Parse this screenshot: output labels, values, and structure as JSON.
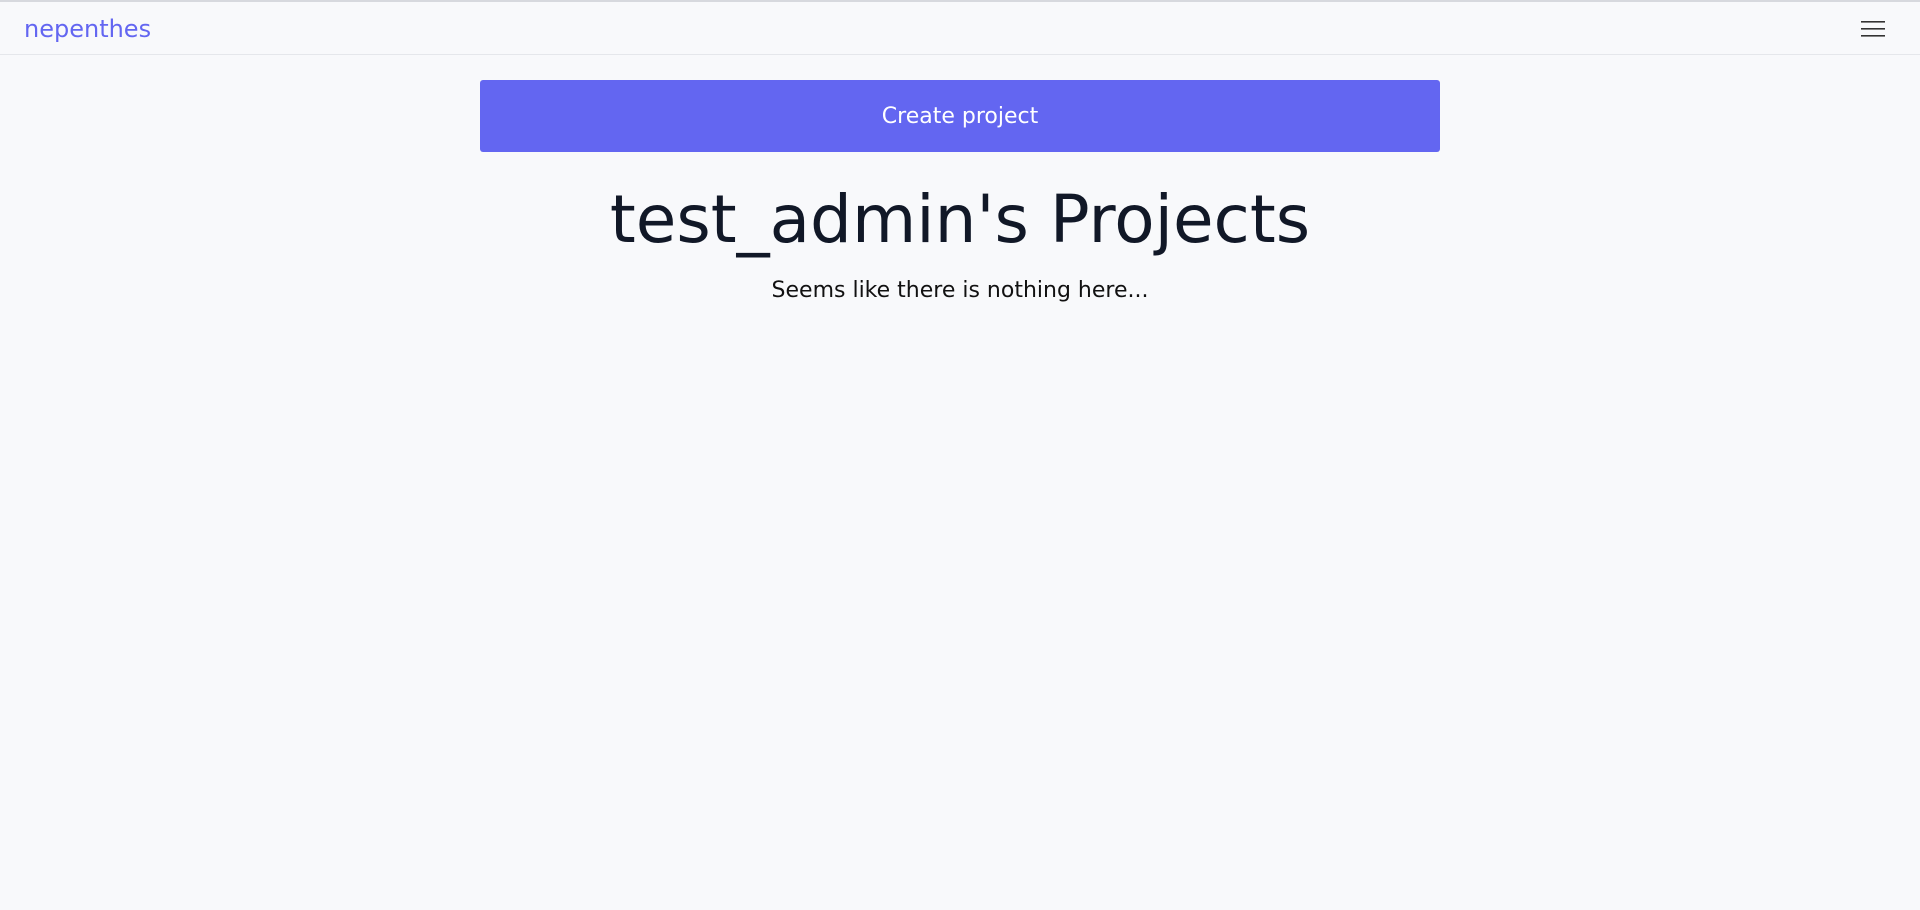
{
  "navbar": {
    "brand": "nepenthes",
    "menu_icon": "hamburger-menu-icon"
  },
  "main": {
    "create_label": "Create project",
    "title": "test_admin's Projects",
    "empty_message": "Seems like there is nothing here..."
  },
  "colors": {
    "accent": "#6366f1",
    "background": "#f8f9fb",
    "title_text": "#111827"
  }
}
